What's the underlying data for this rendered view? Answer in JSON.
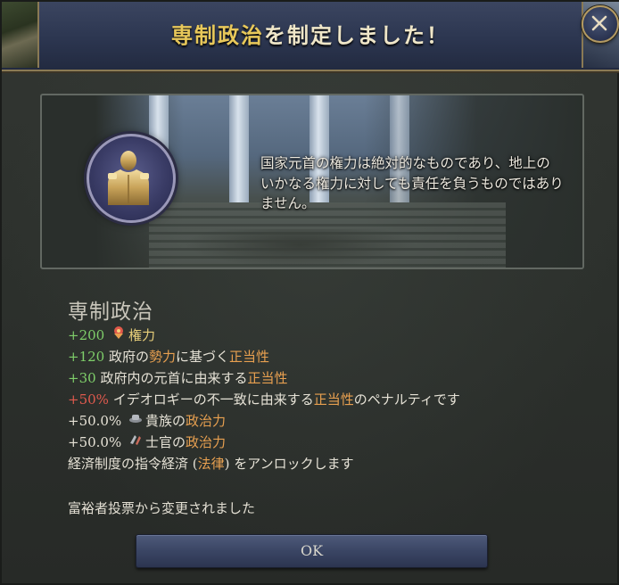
{
  "window": {
    "title_highlight": "専制政治",
    "title_rest": "を制定しました！",
    "close_icon": "close-icon"
  },
  "illustration": {
    "quote": "国家元首の権力は絶対的なものであり、地上のいかなる権力に対しても責任を負うものではありません。",
    "portrait_icon": "head-of-state-portrait-icon"
  },
  "law": {
    "name": "専制政治",
    "effects": [
      {
        "value": "+200",
        "icon": "authority-icon",
        "label": "権力"
      },
      {
        "value": "+120",
        "pre": "政府の",
        "mid": "勢力",
        "mid2": "に基づく",
        "key": "正当性"
      },
      {
        "value": "+30",
        "pre": "政府内の元首に由来する",
        "key": "正当性"
      },
      {
        "value": "+50%",
        "pre": "イデオロギーの不一致に由来する",
        "key": "正当性",
        "post": "のペナルティです"
      },
      {
        "value": "+50.0%",
        "icon": "aristocrats-icon",
        "pre": "貴族の",
        "key": "政治力"
      },
      {
        "value": "+50.0%",
        "icon": "officers-icon",
        "pre": "士官の",
        "key": "政治力"
      }
    ],
    "unlock": {
      "pre": "経済制度の指令経済 (",
      "key": "法律",
      "post": ") をアンロックします"
    },
    "changed_from": "富裕者投票から変更されました"
  },
  "buttons": {
    "ok": "OK"
  },
  "colors": {
    "positive": "#7fcf6a",
    "negative": "#e05a4e",
    "concept": "#e8a050",
    "highlight": "#e8cf7a"
  }
}
